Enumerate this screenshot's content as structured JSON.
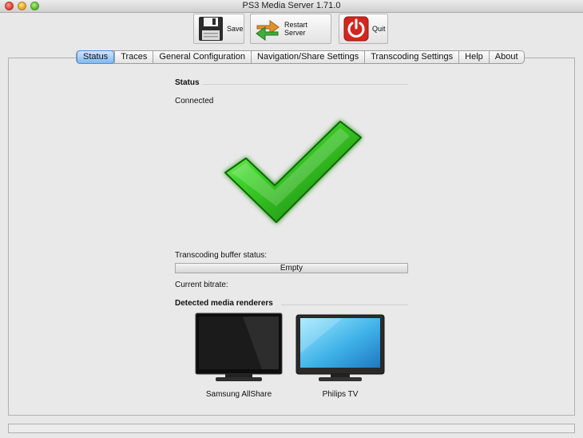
{
  "window": {
    "title": "PS3 Media Server 1.71.0"
  },
  "toolbar": {
    "save_label": "Save",
    "restart_label": "Restart Server",
    "quit_label": "Quit"
  },
  "tabs": [
    {
      "label": "Status",
      "active": true
    },
    {
      "label": "Traces",
      "active": false
    },
    {
      "label": "General Configuration",
      "active": false
    },
    {
      "label": "Navigation/Share Settings",
      "active": false
    },
    {
      "label": "Transcoding Settings",
      "active": false
    },
    {
      "label": "Help",
      "active": false
    },
    {
      "label": "About",
      "active": false
    }
  ],
  "status": {
    "section_title": "Status",
    "connection_text": "Connected",
    "status_icon": "checkmark-icon",
    "buffer_label": "Transcoding buffer status:",
    "buffer_value": "Empty",
    "bitrate_label": "Current bitrate:",
    "renderers_title": "Detected media renderers",
    "renderers": [
      {
        "name": "Samsung AllShare",
        "icon": "tv-dark-icon"
      },
      {
        "name": "Philips TV",
        "icon": "tv-blue-icon"
      }
    ]
  },
  "colors": {
    "accent": "#4f8fd6",
    "check_green": "#2fbf1f",
    "quit_red": "#d3261e"
  }
}
